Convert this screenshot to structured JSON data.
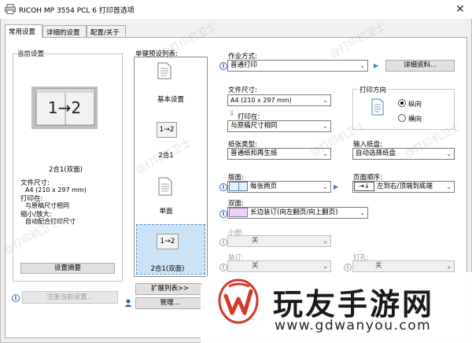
{
  "window": {
    "title": "RICOH MP 3554 PCL 6 打印首选项",
    "close": "✕"
  },
  "tabs": [
    {
      "label": "常用设置",
      "active": true
    },
    {
      "label": "详细的设置",
      "active": false
    },
    {
      "label": "配置/关于",
      "active": false
    }
  ],
  "current_settings": {
    "heading": "当前设置",
    "preview_text": "1→2",
    "caption": "2合1(双面)",
    "paper_size_label": "文件尺寸:",
    "paper_size_value": "A4 (210 x 297 mm)",
    "print_on_label": "打印在:",
    "print_on_value": "与原稿尺寸相同",
    "scale_label": "缩小/放大:",
    "scale_value": "自动配合打印尺寸",
    "summary_button": "设置摘要",
    "register_button": "注册当前设置..."
  },
  "presets": {
    "heading": "单键预设列表:",
    "items": [
      {
        "label": "基本设置",
        "icon": "document-icon"
      },
      {
        "label": "2合1",
        "icon": "two-in-one-icon",
        "glyph": "1→2"
      },
      {
        "label": "单面",
        "icon": "document-icon"
      },
      {
        "label": "2合1(双面)",
        "icon": "two-in-one-duplex-icon",
        "glyph": "1→2",
        "selected": true
      }
    ],
    "expand_button": "扩展列表>>",
    "manage_button": "管理..."
  },
  "job": {
    "label": "作业方式:",
    "value": "普通打印",
    "details_button": "详细资料..."
  },
  "paper": {
    "size_label": "文件尺寸:",
    "size_value": "A4 (210 x 297 mm)",
    "print_on_label": "打印在:",
    "print_on_value": "与原稿尺寸相同"
  },
  "orientation": {
    "heading": "打印方向",
    "options": [
      {
        "label": "纵向",
        "selected": true
      },
      {
        "label": "横向",
        "selected": false
      }
    ]
  },
  "paper_type": {
    "label": "纸张类型:",
    "value": "普通纸和再生纸"
  },
  "input_tray": {
    "label": "输入纸盘:",
    "value": "自动选择纸盘"
  },
  "layout": {
    "label": "版面:",
    "value": "每张两页"
  },
  "page_order": {
    "label": "页面顺序:",
    "value": "左到右/顶端到底端"
  },
  "duplex": {
    "label": "双面:",
    "value": "长边装订(向左翻页/向上翻页)"
  },
  "booklet": {
    "label": "小册:",
    "value": "关"
  },
  "staple": {
    "label": "装订:",
    "value": "关"
  },
  "punch": {
    "label": "打孔:",
    "value": "关"
  },
  "watermarks": [
    "@打印机卫士",
    "@打印机卫士",
    "@打印机卫士",
    "@打印机卫士",
    "@打印机卫士",
    "@打印机卫士"
  ],
  "banner": {
    "brand": "玩友手游网",
    "url": "www.gdwanyou.com"
  }
}
